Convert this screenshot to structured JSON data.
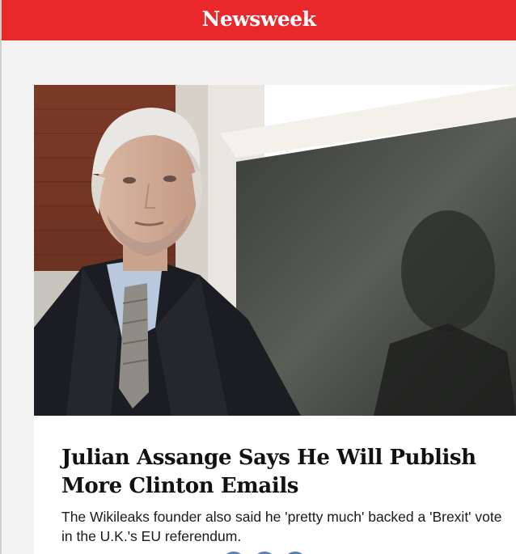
{
  "header": {
    "logo_text": "Newsweek",
    "brand_color": "#e8282b"
  },
  "article": {
    "image_icon": "photo-image",
    "headline": "Julian Assange Says He Will Publish More Clinton Emails",
    "dek": "The Wikileaks founder also said he 'pretty much' backed a 'Brexit' vote in the U.K.'s EU referendum."
  },
  "share": {
    "icons": [
      "share-icon",
      "share-icon",
      "share-icon"
    ]
  }
}
